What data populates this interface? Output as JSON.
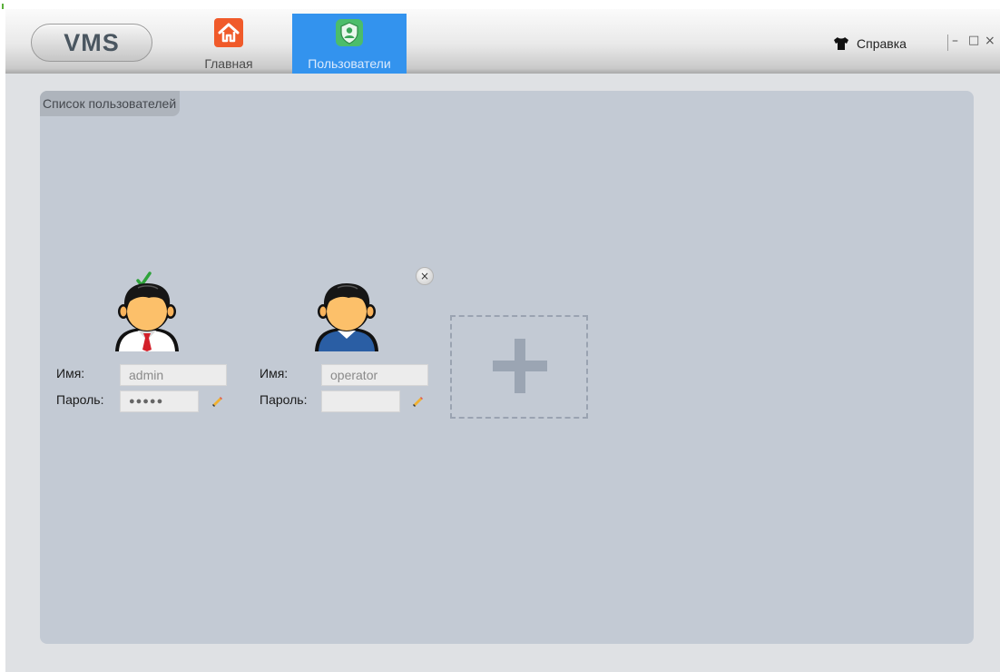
{
  "app": {
    "logo": "VMS",
    "tabs": [
      {
        "label": "Главная",
        "icon": "home-icon",
        "active": false
      },
      {
        "label": "Пользователи",
        "icon": "user-shield-icon",
        "active": true
      }
    ],
    "help_label": "Справка",
    "accent_color": "#3393ee"
  },
  "window_controls": {
    "minimize": "–",
    "maximize": "□",
    "close": "×"
  },
  "panel": {
    "title": "Список пользователей",
    "users": [
      {
        "name_label": "Имя:",
        "name_value": "admin",
        "password_label": "Пароль:",
        "password_value": "●●●●●",
        "current": true,
        "avatar": "admin-avatar-icon"
      },
      {
        "name_label": "Имя:",
        "name_value": "operator",
        "password_label": "Пароль:",
        "password_value": "",
        "current": false,
        "avatar": "operator-avatar-icon"
      }
    ],
    "remove_label": "×",
    "add_user_icon": "plus-icon"
  }
}
